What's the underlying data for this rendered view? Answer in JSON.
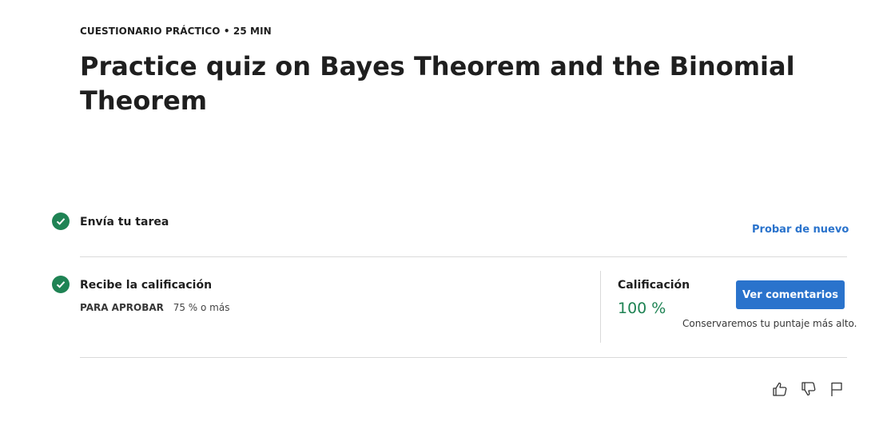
{
  "header": {
    "meta": "CUESTIONARIO PRÁCTICO • 25 MIN",
    "title": "Practice quiz on Bayes Theorem and the Binomial Theorem"
  },
  "steps": [
    {
      "icon": "check-circle-icon",
      "title": "Envía tu tarea",
      "action": "Probar de nuevo"
    },
    {
      "icon": "check-circle-icon",
      "title": "Recibe la calificación"
    }
  ],
  "passing": {
    "label": "PARA APROBAR",
    "value": "75 % o más"
  },
  "grade": {
    "label": "Calificación",
    "value": "100 %",
    "button": "Ver comentarios",
    "note": "Conservaremos tu puntaje más alto."
  },
  "feedback_icons": [
    "thumbs-up-icon",
    "thumbs-down-icon",
    "flag-icon"
  ],
  "colors": {
    "accent": "#2a73cc",
    "success": "#1f8354",
    "text": "#1f1f1f",
    "divider": "#dadada"
  }
}
